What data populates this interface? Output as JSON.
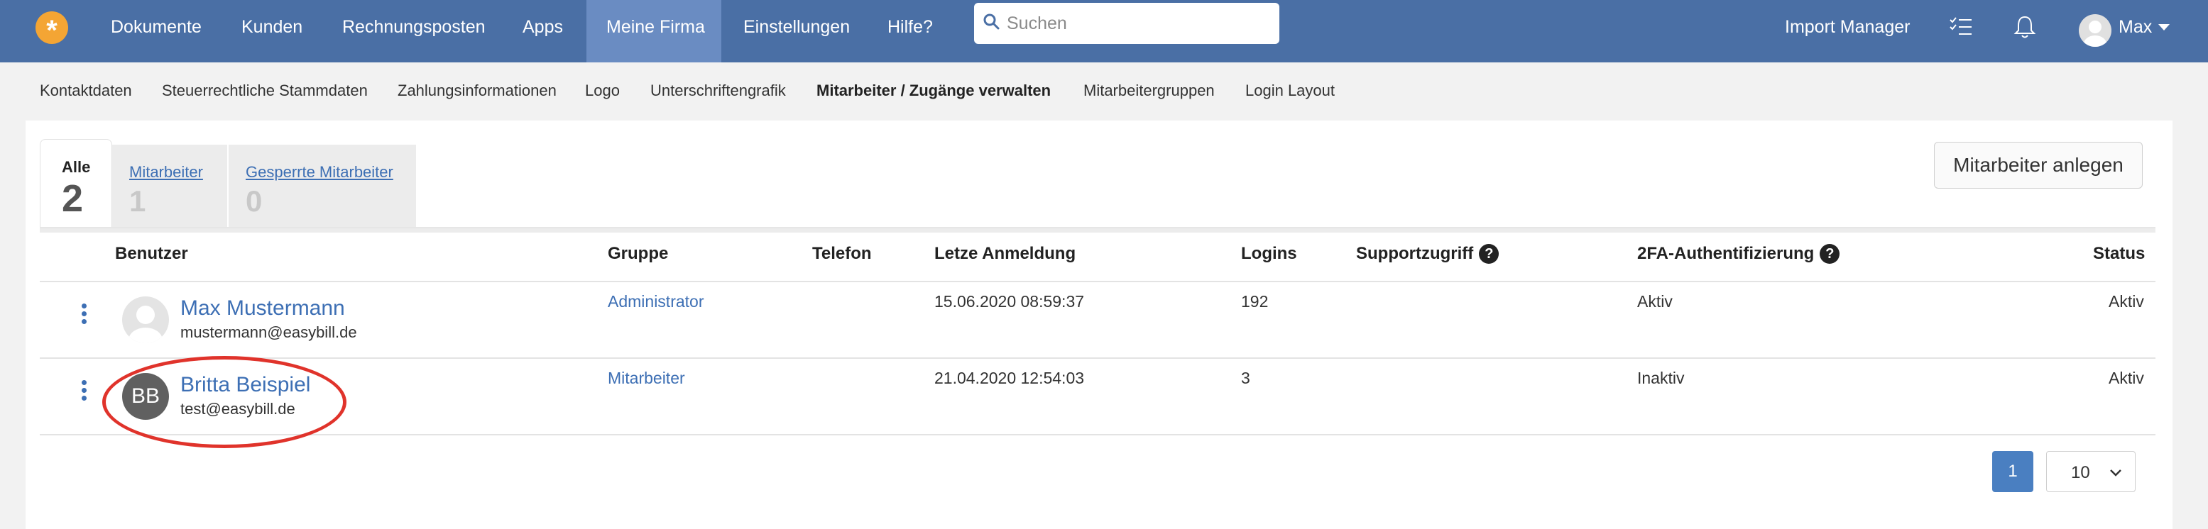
{
  "nav": {
    "items": [
      "Dokumente",
      "Kunden",
      "Rechnungsposten",
      "Apps",
      "Meine Firma",
      "Einstellungen",
      "Hilfe?"
    ],
    "active": "Meine Firma",
    "search_placeholder": "Suchen",
    "import_manager": "Import Manager",
    "user": "Max",
    "icons": [
      "logo-asterisk-icon",
      "search-icon",
      "checklist-icon",
      "bell-icon",
      "user-avatar-icon",
      "caret-down-icon"
    ]
  },
  "subnav": {
    "items": [
      "Kontaktdaten",
      "Steuerrechtliche Stammdaten",
      "Zahlungsinformationen",
      "Logo",
      "Unterschriftengrafik",
      "Mitarbeiter / Zugänge verwalten",
      "Mitarbeitergruppen",
      "Login Layout"
    ],
    "active": "Mitarbeiter / Zugänge verwalten"
  },
  "tabs": [
    {
      "label": "Alle",
      "count": "2"
    },
    {
      "label": "Mitarbeiter",
      "count": "1"
    },
    {
      "label": "Gesperrte Mitarbeiter",
      "count": "0"
    }
  ],
  "add_button": "Mitarbeiter anlegen",
  "table": {
    "headers": [
      "Benutzer",
      "Gruppe",
      "Telefon",
      "Letze Anmeldung",
      "Logins",
      "Supportzugriff",
      "2FA-Authentifizierung",
      "Status"
    ],
    "rows": [
      {
        "name": "Max Mustermann",
        "email": "mustermann@easybill.de",
        "avatar": "photo",
        "initials": "",
        "group": "Administrator",
        "phone": "",
        "last_login": "15.06.2020 08:59:37",
        "logins": "192",
        "support": "",
        "twofa": "Aktiv",
        "status": "Aktiv"
      },
      {
        "name": "Britta Beispiel",
        "email": "test@easybill.de",
        "avatar": "initials",
        "initials": "BB",
        "group": "Mitarbeiter",
        "phone": "",
        "last_login": "21.04.2020 12:54:03",
        "logins": "3",
        "support": "",
        "twofa": "Inaktiv",
        "status": "Aktiv"
      }
    ]
  },
  "pagination": {
    "current_page": "1",
    "per_page": "10"
  },
  "colors": {
    "nav_bg": "#4a6fa5",
    "nav_active": "#6a8cc2",
    "link": "#3d6fb4",
    "highlight": "#e0332b",
    "logo": "#f4a534"
  }
}
